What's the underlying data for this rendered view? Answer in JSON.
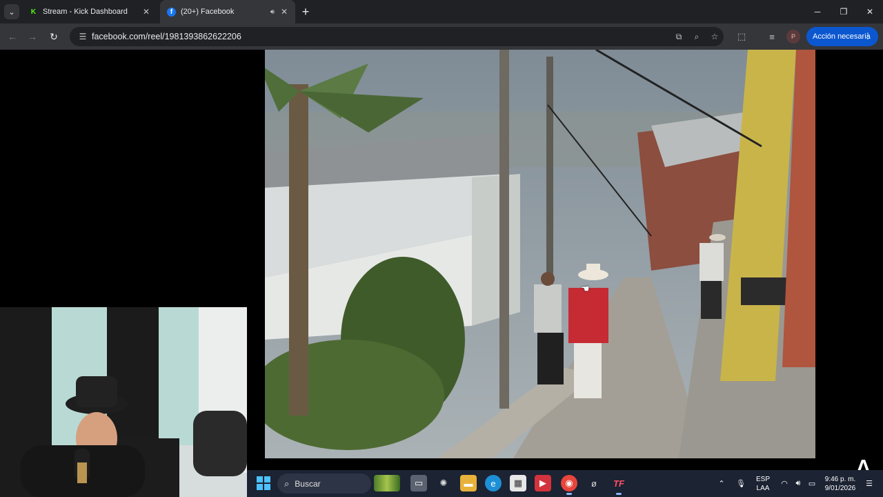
{
  "browser": {
    "tabs": [
      {
        "title": "Stream - Kick Dashboard",
        "favicon": "kick-logo-icon",
        "active": false
      },
      {
        "title": "(20+) Facebook",
        "favicon": "facebook-logo-icon",
        "active": true,
        "audio": true
      }
    ],
    "url": "facebook.com/reel/1981393862622206",
    "profile_initial": "P",
    "action_label": "Acción necesaria",
    "accent_color": "#0b57d0"
  },
  "taskbar": {
    "search_label": "Buscar",
    "apps": [
      "file-explorer-icon",
      "task-view-icon",
      "chatgpt-icon",
      "folder-icon",
      "edge-icon",
      "store-icon",
      "video-editor-icon",
      "chrome-icon",
      "app-icon",
      "tf-icon"
    ],
    "language_top": "ESP",
    "language_bottom": "LAA",
    "time": "9:46 p. m.",
    "date": "9/01/2026"
  },
  "colors": {
    "taskbar_bg": "#1c2333",
    "chrome_dark": "#202124",
    "chrome_toolbar": "#35363a"
  }
}
